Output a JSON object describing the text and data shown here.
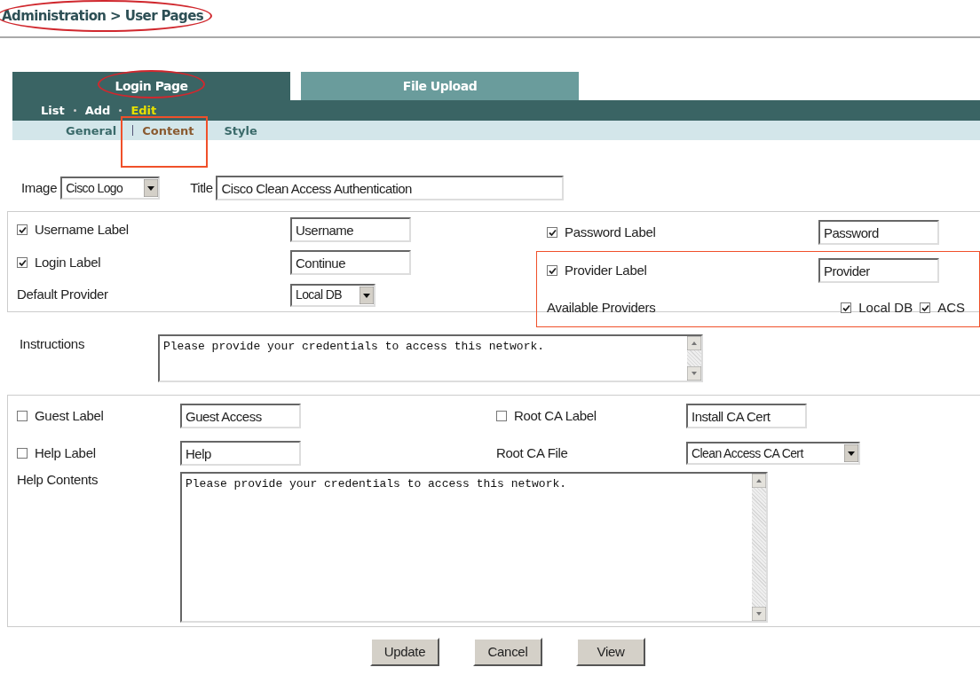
{
  "breadcrumb": {
    "text": "Administration > User Pages",
    "highlighted": true
  },
  "tabs": [
    {
      "label": "Login Page",
      "selected": true,
      "highlighted": true
    },
    {
      "label": "File Upload",
      "selected": false,
      "highlighted": false
    }
  ],
  "actions": [
    {
      "label": "List",
      "selected": false
    },
    {
      "label": "Add",
      "selected": false
    },
    {
      "label": "Edit",
      "selected": true
    }
  ],
  "subtabs": [
    {
      "label": "General",
      "selected": false,
      "highlighted": false
    },
    {
      "label": "Content",
      "selected": true,
      "highlighted": true
    },
    {
      "label": "Style",
      "selected": false,
      "highlighted": false
    }
  ],
  "image": {
    "label": "Image",
    "value": "Cisco Logo"
  },
  "title": {
    "label": "Title",
    "value": "Cisco Clean Access Authentication"
  },
  "labels_left": [
    {
      "kind": "check",
      "label": "Username Label",
      "checked": true,
      "value": "Username"
    },
    {
      "kind": "check",
      "label": "Login Label",
      "checked": true,
      "value": "Continue"
    },
    {
      "kind": "select",
      "label": "Default Provider",
      "value": "Local DB"
    }
  ],
  "labels_right": [
    {
      "kind": "check",
      "label": "Password Label",
      "checked": true,
      "value": "Password"
    }
  ],
  "provider_group": {
    "highlighted": true,
    "items": [
      {
        "kind": "check",
        "label": "Provider Label",
        "checked": true,
        "value": "Provider"
      },
      {
        "kind": "options",
        "label": "Available Providers",
        "options": [
          {
            "label": "Local DB",
            "checked": true
          },
          {
            "label": "ACS",
            "checked": true
          }
        ]
      }
    ]
  },
  "instructions": {
    "label": "Instructions",
    "value": "Please provide your credentials to access this network."
  },
  "extras_left": [
    {
      "kind": "check",
      "label": "Guest Label",
      "checked": false,
      "value": "Guest Access"
    },
    {
      "kind": "check",
      "label": "Help Label",
      "checked": false,
      "value": "Help"
    }
  ],
  "extras_right": [
    {
      "kind": "check",
      "label": "Root CA Label",
      "checked": false,
      "value": "Install CA Cert"
    },
    {
      "kind": "select",
      "label": "Root CA File",
      "value": "Clean Access CA Cert"
    }
  ],
  "help_contents": {
    "label": "Help Contents",
    "value": "Please provide your credentials to access this network."
  },
  "buttons": [
    "Update",
    "Cancel",
    "View"
  ]
}
